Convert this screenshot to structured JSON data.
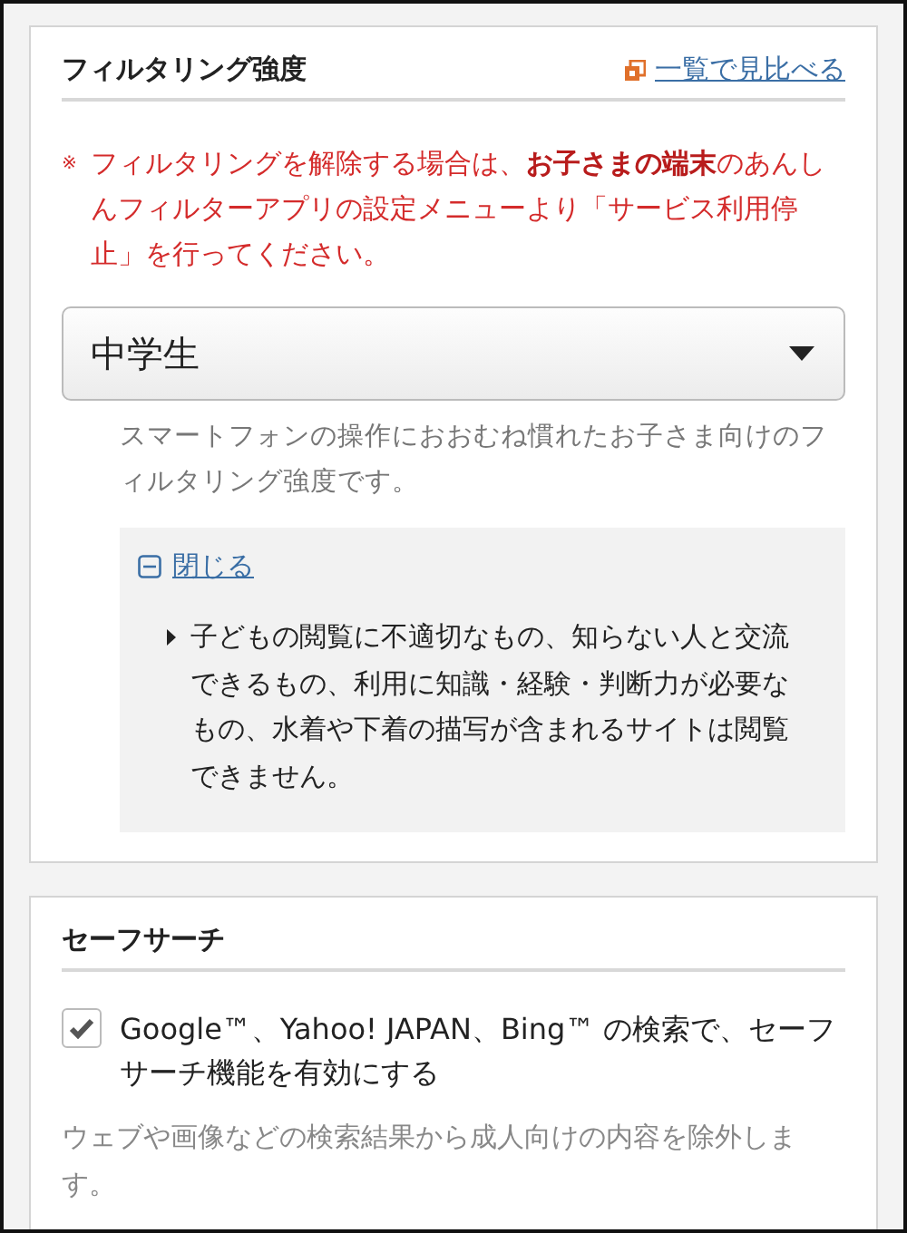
{
  "filter_section": {
    "title": "フィルタリング強度",
    "compare_link": "一覧で見比べる",
    "note_mark": "※",
    "note": "フィルタリングを解除する場合は、**お子さまの端末**のあんしんフィルターアプリの設定メニューより「サービス利用停止」を行ってください。",
    "select": {
      "value": "中学生"
    },
    "description": "スマートフォンの操作におおむね慣れたお子さま向けのフィルタリング強度です。",
    "details": {
      "expanded": true,
      "toggle_label": "閉じる",
      "items": [
        "子どもの閲覧に不適切なもの、知らない人と交流できるもの、利用に知識・経験・判断力が必要なもの、水着や下着の描写が含まれるサイトは閲覧できません。"
      ]
    }
  },
  "safe_search": {
    "title": "セーフサーチ",
    "checkbox": {
      "label": "Google™、Yahoo! JAPAN、Bing™ の検索で、セーフサーチ機能を有効にする",
      "checked": true
    },
    "description": "ウェブや画像などの検索結果から成人向けの内容を除外します。"
  }
}
